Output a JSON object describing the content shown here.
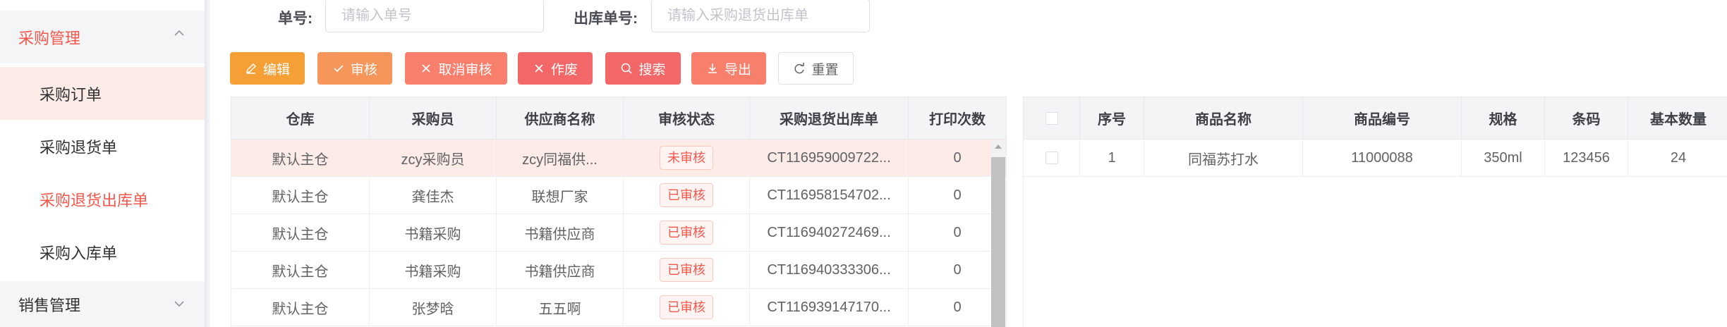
{
  "sidebar": {
    "purchase_group": "采购管理",
    "items": [
      {
        "label": "采购订单"
      },
      {
        "label": "采购退货单"
      },
      {
        "label": "采购退货出库单"
      },
      {
        "label": "采购入库单"
      }
    ],
    "sales_group": "销售管理"
  },
  "filters": {
    "order_no_label": "单号:",
    "order_no_placeholder": "请输入单号",
    "outbound_no_label": "出库单号:",
    "outbound_no_placeholder": "请输入采购退货出库单"
  },
  "toolbar": {
    "edit": "编辑",
    "approve": "审核",
    "cancel_approve": "取消审核",
    "void": "作废",
    "search": "搜索",
    "export": "导出",
    "reset": "重置"
  },
  "main_table": {
    "columns": [
      "仓库",
      "采购员",
      "供应商名称",
      "审核状态",
      "采购退货出库单",
      "打印次数"
    ],
    "rows": [
      {
        "warehouse": "默认主仓",
        "buyer": "zcy采购员",
        "supplier": "zcy同福供...",
        "status": "未审核",
        "doc_no": "CT116959009722...",
        "prints": "0"
      },
      {
        "warehouse": "默认主仓",
        "buyer": "龚佳杰",
        "supplier": "联想厂家",
        "status": "已审核",
        "doc_no": "CT116958154702...",
        "prints": "0"
      },
      {
        "warehouse": "默认主仓",
        "buyer": "书籍采购",
        "supplier": "书籍供应商",
        "status": "已审核",
        "doc_no": "CT116940272469...",
        "prints": "0"
      },
      {
        "warehouse": "默认主仓",
        "buyer": "书籍采购",
        "supplier": "书籍供应商",
        "status": "已审核",
        "doc_no": "CT116940333306...",
        "prints": "0"
      },
      {
        "warehouse": "默认主仓",
        "buyer": "张梦晗",
        "supplier": "五五啊",
        "status": "已审核",
        "doc_no": "CT116939147170...",
        "prints": "0"
      }
    ]
  },
  "detail_table": {
    "columns": [
      "序号",
      "商品名称",
      "商品编号",
      "规格",
      "条码",
      "基本数量"
    ],
    "rows": [
      {
        "index": "1",
        "name": "同福苏打水",
        "code": "11000088",
        "spec": "350ml",
        "barcode": "123456",
        "qty": "24"
      }
    ]
  },
  "colors": {
    "accent": "#f5574b",
    "selected_bg": "#fdebe7",
    "edit_btn": "#f4a036",
    "approve_btn": "#f6965a",
    "cancel_btn": "#f77f6c",
    "void_btn": "#f46768"
  },
  "icons": {
    "edit": "pencil-icon",
    "approve": "check-icon",
    "cancel": "close-icon",
    "void": "close-icon",
    "search": "search-icon",
    "export": "download-icon",
    "reset": "refresh-icon",
    "group_toggle": "chevron-icon"
  }
}
